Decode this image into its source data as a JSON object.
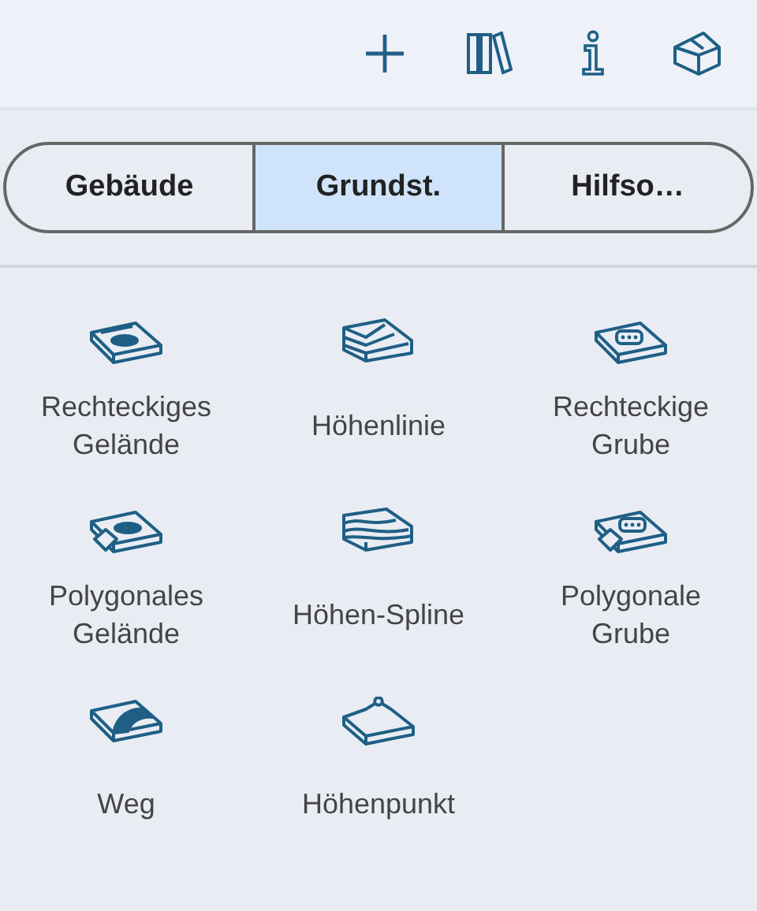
{
  "segments": [
    {
      "label": "Gebäude",
      "selected": false
    },
    {
      "label": "Grundst.",
      "selected": true
    },
    {
      "label": "Hilfso…",
      "selected": false
    }
  ],
  "tools": [
    {
      "label": "Rechteckiges Gelände"
    },
    {
      "label": "Höhenlinie"
    },
    {
      "label": "Rechteckige Grube"
    },
    {
      "label": "Polygonales Gelände"
    },
    {
      "label": "Höhen-Spline"
    },
    {
      "label": "Polygonale Grube"
    },
    {
      "label": "Weg"
    },
    {
      "label": "Höhenpunkt"
    }
  ]
}
